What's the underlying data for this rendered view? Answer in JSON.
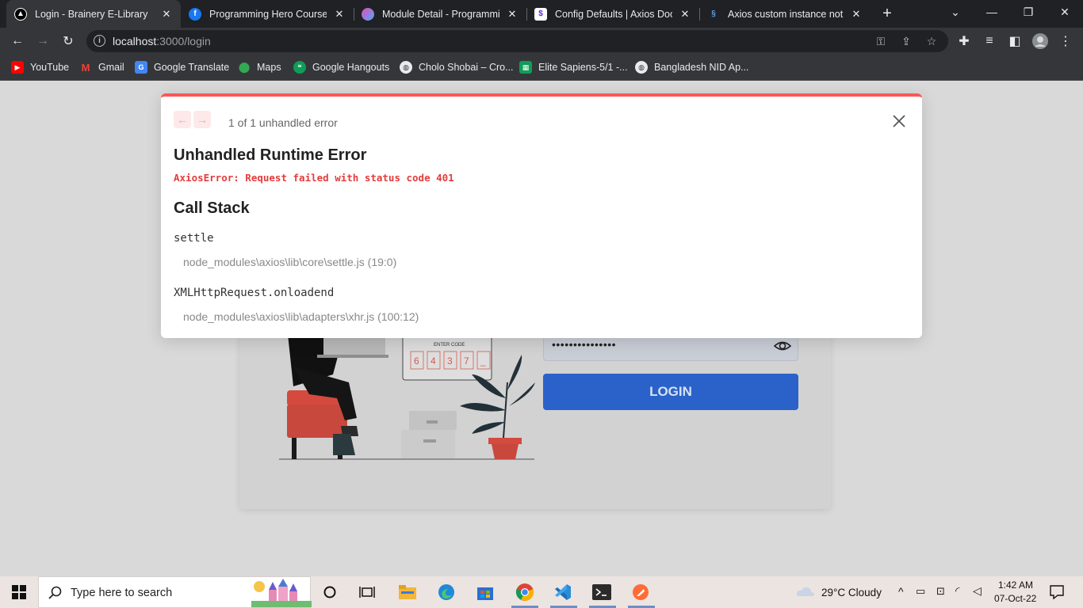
{
  "browser": {
    "tabs": [
      {
        "title": "Login - Brainery E-Library",
        "icon": "next-icon",
        "active": true
      },
      {
        "title": "Programming Hero Courses |",
        "icon": "facebook-icon",
        "active": false
      },
      {
        "title": "Module Detail - Programmin",
        "icon": "programming-hero-icon",
        "active": false
      },
      {
        "title": "Config Defaults | Axios Docs",
        "icon": "axios-icon",
        "active": false
      },
      {
        "title": "Axios custom instance not w",
        "icon": "stackoverflow-icon",
        "active": false
      }
    ],
    "new_tab": "+",
    "url_host": "localhost",
    "url_rest": ":3000/login",
    "bookmarks": [
      {
        "label": "YouTube",
        "icon": "youtube-icon",
        "color": "#ff0000"
      },
      {
        "label": "Gmail",
        "icon": "gmail-icon",
        "color": "#ea4335"
      },
      {
        "label": "Google Translate",
        "icon": "translate-icon",
        "color": "#4285f4"
      },
      {
        "label": "Maps",
        "icon": "maps-icon",
        "color": "#34a853"
      },
      {
        "label": "Google Hangouts",
        "icon": "hangouts-icon",
        "color": "#0f9d58"
      },
      {
        "label": "Cholo Shobai – Cro...",
        "icon": "globe-icon",
        "color": "#e8eaed"
      },
      {
        "label": "Elite Sapiens-5/1 -...",
        "icon": "sheets-icon",
        "color": "#0f9d58"
      },
      {
        "label": "Bangladesh NID Ap...",
        "icon": "globe-icon",
        "color": "#e8eaed"
      }
    ]
  },
  "page": {
    "password_dots": "•••••••••••••••",
    "login_label": "LOGIN",
    "illustration": {
      "code_label": "ENTER CODE",
      "code_digits": [
        "6",
        "4",
        "3",
        "7",
        "_"
      ]
    }
  },
  "error_overlay": {
    "count_text": "1 of 1 unhandled error",
    "title": "Unhandled Runtime Error",
    "message": "AxiosError: Request failed with status code 401",
    "call_stack_title": "Call Stack",
    "frames": [
      {
        "fn": "settle",
        "file": "node_modules\\axios\\lib\\core\\settle.js (19:0)"
      },
      {
        "fn": "XMLHttpRequest.onloadend",
        "file": "node_modules\\axios\\lib\\adapters\\xhr.js (100:12)"
      }
    ],
    "accent": "#ff5555"
  },
  "taskbar": {
    "search_placeholder": "Type here to search",
    "weather": "29°C  Cloudy",
    "time": "1:42 AM",
    "date": "07-Oct-22"
  }
}
